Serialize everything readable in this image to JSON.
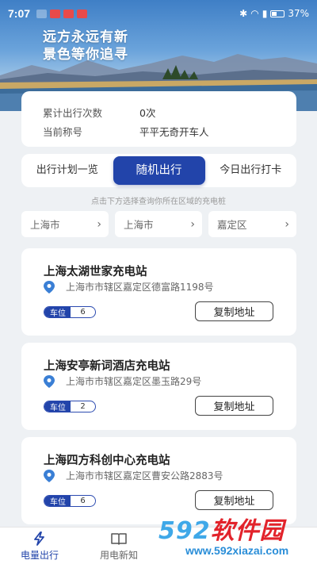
{
  "status": {
    "time": "7:07",
    "battery": "37%"
  },
  "hero": {
    "line1": "远方永远有新",
    "line2": "景色等你追寻"
  },
  "stats": {
    "trips_label": "累计出行次数",
    "trips_value": "0次",
    "title_label": "当前称号",
    "title_value": "平平无奇开车人"
  },
  "tabs": [
    {
      "label": "出行计划一览"
    },
    {
      "label": "随机出行"
    },
    {
      "label": "今日出行打卡"
    }
  ],
  "hint": "点击下方选择查询你所在区域的充电桩",
  "selectors": [
    {
      "value": "上海市"
    },
    {
      "value": "上海市"
    },
    {
      "value": "嘉定区"
    }
  ],
  "stations": [
    {
      "name": "上海太湖世家充电站",
      "address": "上海市市辖区嘉定区德富路1198号",
      "slot_label": "车位",
      "slot_count": "6",
      "copy_label": "复制地址"
    },
    {
      "name": "上海安亭新词酒店充电站",
      "address": "上海市市辖区嘉定区墨玉路29号",
      "slot_label": "车位",
      "slot_count": "2",
      "copy_label": "复制地址"
    },
    {
      "name": "上海四方科创中心充电站",
      "address": "上海市市辖区嘉定区曹安公路2883号",
      "slot_label": "车位",
      "slot_count": "6",
      "copy_label": "复制地址"
    }
  ],
  "nav": [
    {
      "label": "电量出行",
      "icon": "lightning-icon"
    },
    {
      "label": "用电新知",
      "icon": "book-icon"
    }
  ],
  "watermark": {
    "title_num": "592",
    "title_text": "软件园",
    "url": "www.592xiazai.com"
  },
  "colors": {
    "accent": "#2244aa"
  }
}
